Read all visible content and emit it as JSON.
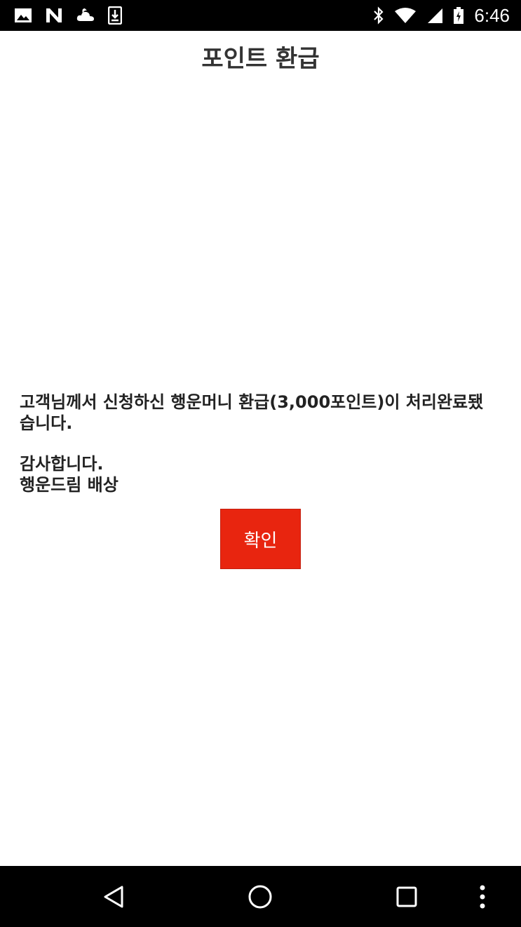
{
  "status_bar": {
    "time": "6:46",
    "left_icons": [
      "image-icon",
      "n-notification-icon",
      "cloud-weather-icon",
      "download-icon"
    ],
    "right_icons": [
      "bluetooth-icon",
      "wifi-icon",
      "cell-signal-icon",
      "battery-icon"
    ]
  },
  "page": {
    "title": "포인트 환급"
  },
  "message": {
    "line1": "고객님께서 신청하신 행운머니 환급(3,000포인트)이 처리완료됐",
    "line2": "습니다.",
    "line3": "감사합니다.",
    "line4": "행운드림 배상"
  },
  "actions": {
    "confirm_label": "확인"
  },
  "colors": {
    "accent": "#e8250f",
    "bars": "#000000"
  },
  "nav_bar": {
    "icons": [
      "back-icon",
      "home-icon",
      "recents-icon",
      "more-icon"
    ]
  }
}
